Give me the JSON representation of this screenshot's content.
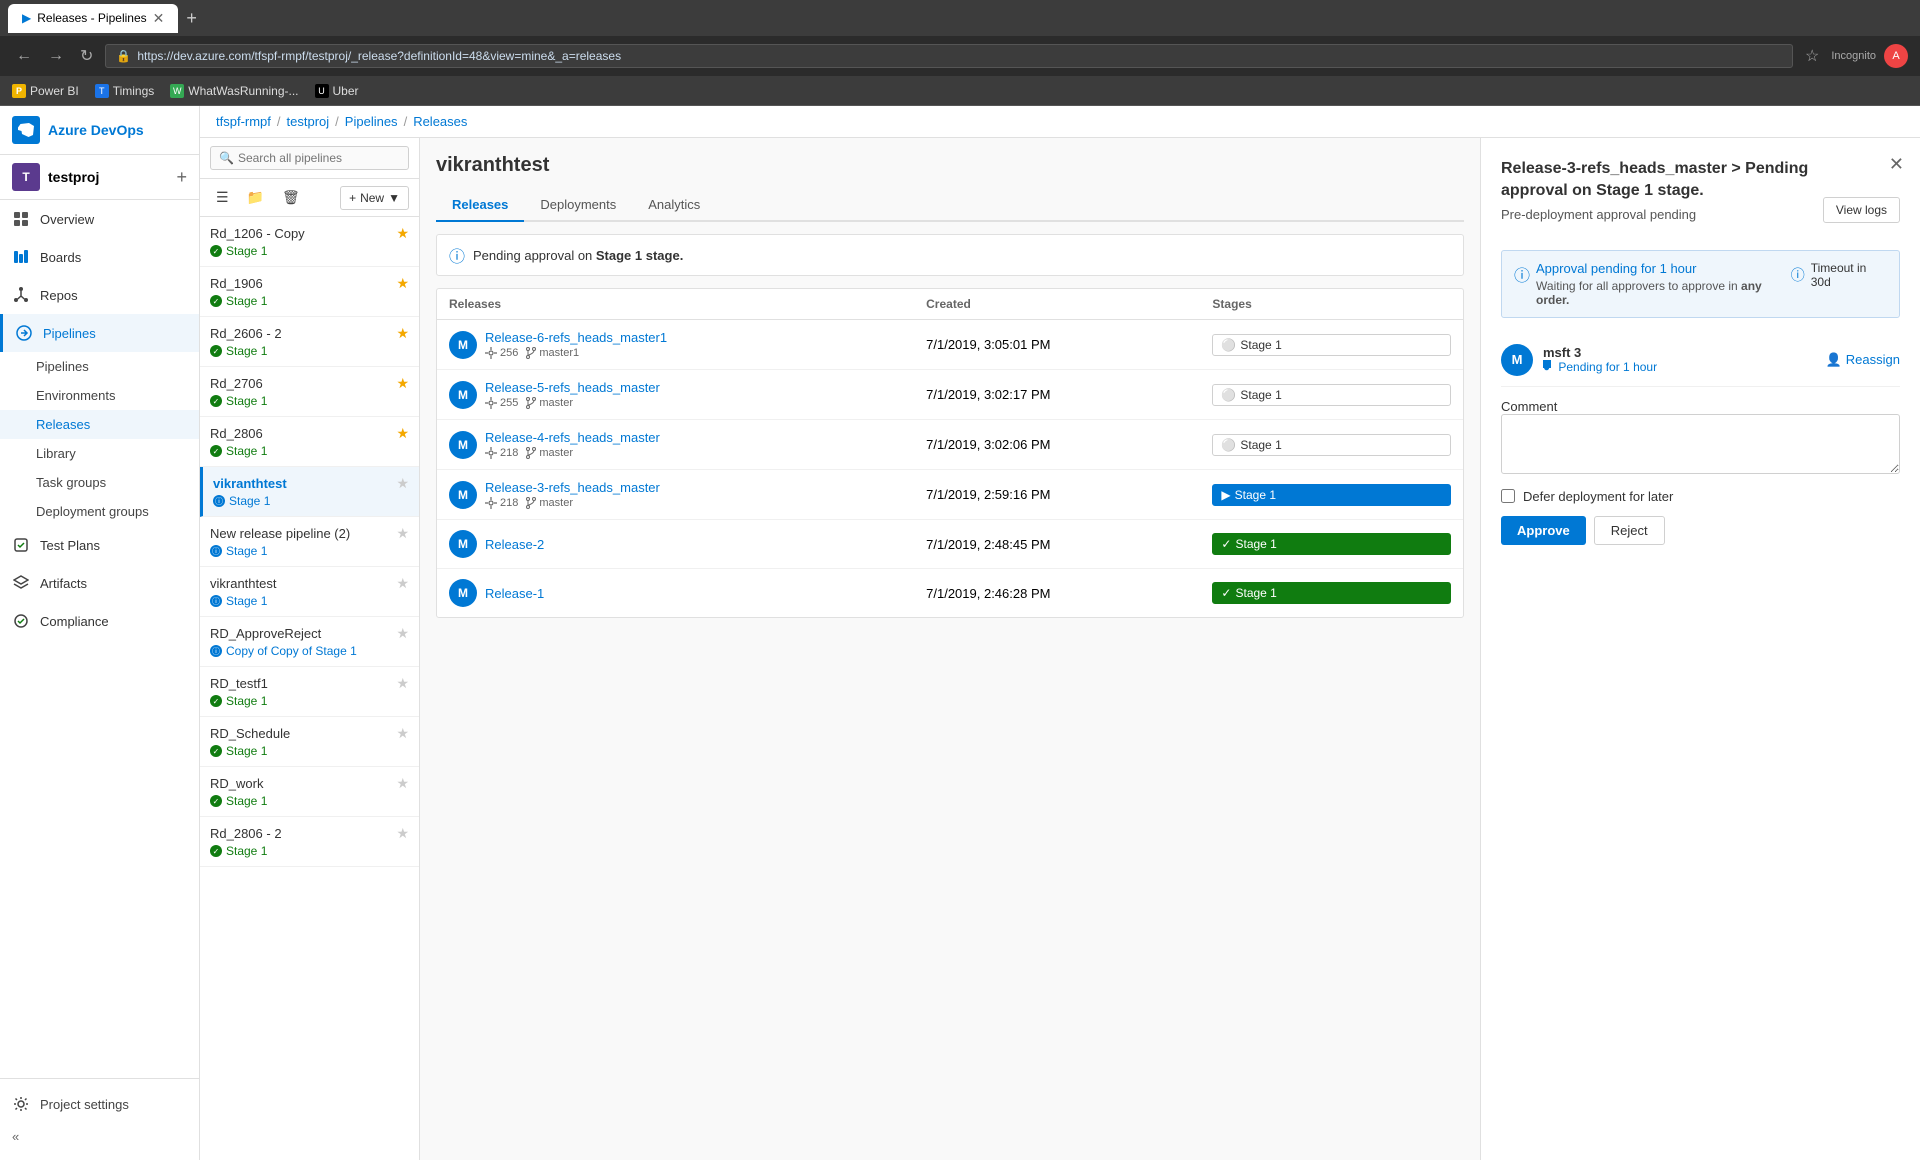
{
  "browser": {
    "tab_title": "Releases - Pipelines",
    "url": "https://dev.azure.com/tfspf-rmpf/testproj/_release?definitionId=48&view=mine&_a=releases",
    "bookmarks": [
      "Power BI",
      "Timings",
      "WhatWasRunning-...",
      "Uber"
    ]
  },
  "sidebar": {
    "brand": "Azure DevOps",
    "project": "testproj",
    "nav_items": [
      {
        "label": "Overview",
        "icon": "home"
      },
      {
        "label": "Boards",
        "icon": "boards"
      },
      {
        "label": "Repos",
        "icon": "repos"
      },
      {
        "label": "Pipelines",
        "icon": "pipelines",
        "active": true
      },
      {
        "label": "Test Plans",
        "icon": "testplans"
      },
      {
        "label": "Artifacts",
        "icon": "artifacts"
      },
      {
        "label": "Compliance",
        "icon": "compliance"
      }
    ],
    "sub_items": [
      {
        "label": "Pipelines"
      },
      {
        "label": "Environments"
      },
      {
        "label": "Releases",
        "active": true
      },
      {
        "label": "Library"
      },
      {
        "label": "Task groups"
      },
      {
        "label": "Deployment groups"
      }
    ],
    "footer": "Project settings"
  },
  "breadcrumb": {
    "items": [
      "tfspf-rmpf",
      "testproj",
      "Pipelines",
      "Releases"
    ]
  },
  "pipeline_list": {
    "search_placeholder": "Search all pipelines",
    "new_button": "New",
    "items": [
      {
        "name": "Rd_1206 - Copy",
        "status": "Stage 1",
        "status_type": "green",
        "starred": true
      },
      {
        "name": "Rd_1906",
        "status": "Stage 1",
        "status_type": "green",
        "starred": true
      },
      {
        "name": "Rd_2606 - 2",
        "status": "Stage 1",
        "status_type": "green",
        "starred": true
      },
      {
        "name": "Rd_2706",
        "status": "Stage 1",
        "status_type": "green",
        "starred": true
      },
      {
        "name": "Rd_2806",
        "status": "Stage 1",
        "status_type": "green",
        "starred": true
      },
      {
        "name": "vikranthtest",
        "status": "Stage 1",
        "status_type": "blue",
        "starred": false,
        "active": true
      },
      {
        "name": "New release pipeline (2)",
        "status": "Stage 1",
        "status_type": "blue",
        "starred": false
      },
      {
        "name": "vikranthtest",
        "status": "Stage 1",
        "status_type": "blue",
        "starred": false
      },
      {
        "name": "RD_ApproveReject",
        "status": "Copy of Copy of Stage 1",
        "status_type": "blue",
        "starred": false
      },
      {
        "name": "RD_testf1",
        "status": "Stage 1",
        "status_type": "green",
        "starred": false
      },
      {
        "name": "RD_Schedule",
        "status": "Stage 1",
        "status_type": "green",
        "starred": false
      },
      {
        "name": "RD_work",
        "status": "Stage 1",
        "status_type": "green",
        "starred": false
      },
      {
        "name": "Rd_2806 - 2",
        "status": "Stage 1",
        "status_type": "green",
        "starred": false
      }
    ]
  },
  "releases_panel": {
    "title": "vikranthtest",
    "tabs": [
      "Releases",
      "Deployments",
      "Analytics"
    ],
    "active_tab": "Releases",
    "pending_banner": "Pending approval on Stage 1 stage.",
    "table": {
      "columns": [
        "Releases",
        "Created",
        "Stages"
      ],
      "rows": [
        {
          "avatar": "M",
          "name": "Release-6-refs_heads_master1",
          "commits": "256",
          "branch": "master1",
          "created": "7/1/2019, 3:05:01 PM",
          "stage": "Stage 1",
          "stage_type": "outline"
        },
        {
          "avatar": "M",
          "name": "Release-5-refs_heads_master",
          "commits": "255",
          "branch": "master",
          "created": "7/1/2019, 3:02:17 PM",
          "stage": "Stage 1",
          "stage_type": "outline"
        },
        {
          "avatar": "M",
          "name": "Release-4-refs_heads_master",
          "commits": "218",
          "branch": "master",
          "created": "7/1/2019, 3:02:06 PM",
          "stage": "Stage 1",
          "stage_type": "outline"
        },
        {
          "avatar": "M",
          "name": "Release-3-refs_heads_master",
          "commits": "218",
          "branch": "master",
          "created": "7/1/2019, 2:59:16 PM",
          "stage": "Stage 1",
          "stage_type": "blue"
        },
        {
          "avatar": "M",
          "name": "Release-2",
          "commits": "",
          "branch": "",
          "created": "7/1/2019, 2:48:45 PM",
          "stage": "Stage 1",
          "stage_type": "green"
        },
        {
          "avatar": "M",
          "name": "Release-1",
          "commits": "",
          "branch": "",
          "created": "7/1/2019, 2:46:28 PM",
          "stage": "Stage 1",
          "stage_type": "green"
        }
      ]
    }
  },
  "approval_panel": {
    "title": "Release-3-refs_heads_master > Pending approval on Stage 1 stage.",
    "subtitle": "Pre-deployment approval pending",
    "view_logs_label": "View logs",
    "info_box": {
      "pending_text": "Approval pending for 1 hour",
      "waiting_text": "Waiting for all approvers to approve in",
      "order_text": "any order.",
      "timeout_text": "Timeout in 30d"
    },
    "approver": {
      "avatar": "M",
      "name": "msft 3",
      "status": "Pending for 1 hour"
    },
    "reassign_label": "Reassign",
    "comment_label": "Comment",
    "comment_placeholder": "",
    "defer_label": "Defer deployment for later",
    "approve_label": "Approve",
    "reject_label": "Reject"
  }
}
